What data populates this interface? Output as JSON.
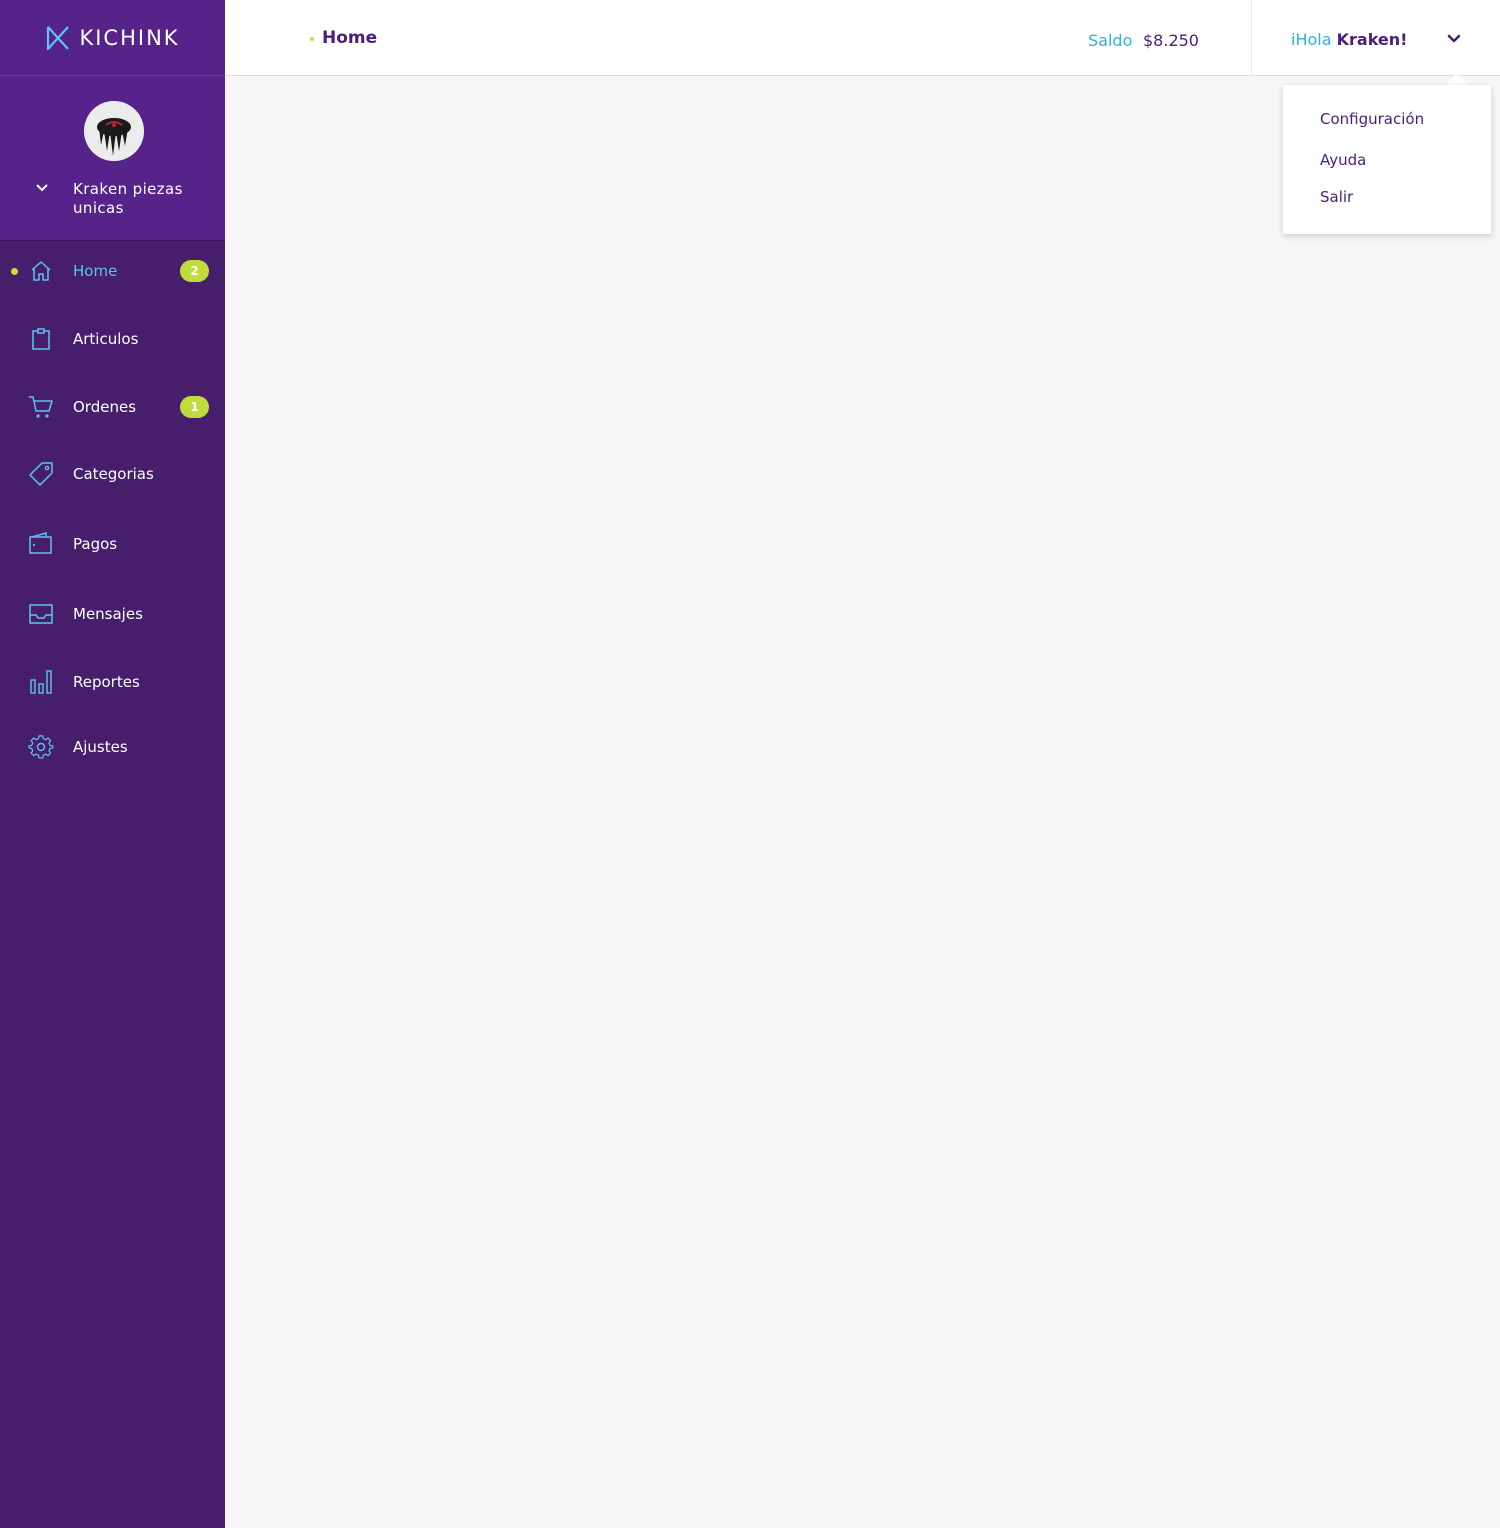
{
  "brand": {
    "name": "KICHINK"
  },
  "store": {
    "name": "Kraken piezas unicas"
  },
  "sidebar": {
    "items": [
      {
        "label": "Home",
        "icon": "home-icon",
        "badge": "2",
        "active": true
      },
      {
        "label": "Articulos",
        "icon": "clipboard-icon",
        "badge": ""
      },
      {
        "label": "Ordenes",
        "icon": "cart-icon",
        "badge": "1"
      },
      {
        "label": "Categorias",
        "icon": "tag-icon",
        "badge": ""
      },
      {
        "label": "Pagos",
        "icon": "wallet-icon",
        "badge": ""
      },
      {
        "label": "Mensajes",
        "icon": "inbox-icon",
        "badge": ""
      },
      {
        "label": "Reportes",
        "icon": "bar-chart-icon",
        "badge": ""
      },
      {
        "label": "Ajustes",
        "icon": "gear-icon",
        "badge": ""
      }
    ]
  },
  "header": {
    "breadcrumb": "Home",
    "saldo_label": "Saldo",
    "saldo_value": "$8.250",
    "greeting": "iHola",
    "user_name": "Kraken!"
  },
  "user_menu": {
    "items": [
      "Configuración",
      "Ayuda",
      "Salir"
    ]
  },
  "colors": {
    "sidebar_bg": "#461e6b",
    "sidebar_top_bg": "#55238a",
    "accent_blue": "#5ec4f1",
    "accent_green": "#c0dc3c",
    "brand_purple": "#4a1f7a",
    "saldo_cyan": "#2bb3d8"
  }
}
